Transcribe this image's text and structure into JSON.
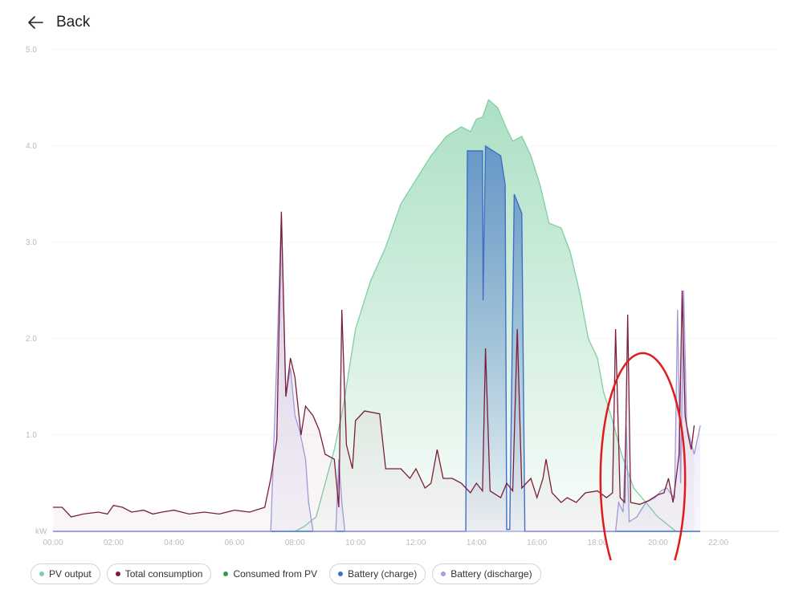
{
  "header": {
    "back_label": "Back",
    "back_icon": "arrow-left-icon"
  },
  "legend": [
    {
      "label": "PV output",
      "color": "#7fd0a7",
      "boxed": true
    },
    {
      "label": "Total consumption",
      "color": "#7b1e3a",
      "boxed": true
    },
    {
      "label": "Consumed from PV",
      "color": "#2e9d4a",
      "boxed": false
    },
    {
      "label": "Battery (charge)",
      "color": "#3f6fc6",
      "boxed": true
    },
    {
      "label": "Battery (discharge)",
      "color": "#a79fe0",
      "boxed": true
    }
  ],
  "chart_data": {
    "type": "area",
    "ylabel": "kW",
    "ylim": [
      0,
      5
    ],
    "yticks": [
      "5.0",
      "4.0",
      "3.0",
      "2.0",
      "1.0"
    ],
    "xticks": [
      "00:00",
      "02:00",
      "04:00",
      "06:00",
      "08:00",
      "10:00",
      "12:00",
      "14:00",
      "16:00",
      "18:00",
      "20:00",
      "22:00"
    ],
    "xlim_hours": [
      0,
      24
    ],
    "grid": true,
    "colors": {
      "pv": "#7fcfa4",
      "consumption": "#7b1e3a",
      "charge": "#3f6fc6",
      "discharge": "#9f98dc",
      "annotation": "#e01b1b"
    },
    "annotation": {
      "shape": "ellipse",
      "center_hour": 19.5,
      "center_kw": 0.55,
      "hour_radius": 1.4,
      "kw_radius": 1.3
    },
    "series": [
      {
        "name": "PV output",
        "points": [
          [
            8.0,
            0
          ],
          [
            8.3,
            0.05
          ],
          [
            8.7,
            0.15
          ],
          [
            9.0,
            0.5
          ],
          [
            9.3,
            0.85
          ],
          [
            9.6,
            1.3
          ],
          [
            10.0,
            2.1
          ],
          [
            10.5,
            2.6
          ],
          [
            11.0,
            2.95
          ],
          [
            11.5,
            3.4
          ],
          [
            12.0,
            3.65
          ],
          [
            12.5,
            3.9
          ],
          [
            13.0,
            4.1
          ],
          [
            13.5,
            4.2
          ],
          [
            13.8,
            4.15
          ],
          [
            14.0,
            4.28
          ],
          [
            14.2,
            4.3
          ],
          [
            14.4,
            4.48
          ],
          [
            14.7,
            4.4
          ],
          [
            15.0,
            4.18
          ],
          [
            15.2,
            4.05
          ],
          [
            15.5,
            4.1
          ],
          [
            15.8,
            3.9
          ],
          [
            16.1,
            3.6
          ],
          [
            16.4,
            3.2
          ],
          [
            16.8,
            3.15
          ],
          [
            17.1,
            2.9
          ],
          [
            17.4,
            2.5
          ],
          [
            17.7,
            2.0
          ],
          [
            18.0,
            1.8
          ],
          [
            18.2,
            1.45
          ],
          [
            18.5,
            1.15
          ],
          [
            18.8,
            0.8
          ],
          [
            19.2,
            0.45
          ],
          [
            19.6,
            0.3
          ],
          [
            20.0,
            0.15
          ],
          [
            20.4,
            0.05
          ],
          [
            20.6,
            0
          ]
        ]
      },
      {
        "name": "Total consumption",
        "points": [
          [
            0.0,
            0.25
          ],
          [
            0.3,
            0.25
          ],
          [
            0.6,
            0.15
          ],
          [
            1.0,
            0.18
          ],
          [
            1.5,
            0.2
          ],
          [
            1.8,
            0.18
          ],
          [
            2.0,
            0.27
          ],
          [
            2.3,
            0.25
          ],
          [
            2.6,
            0.2
          ],
          [
            3.0,
            0.22
          ],
          [
            3.3,
            0.18
          ],
          [
            3.6,
            0.2
          ],
          [
            4.0,
            0.22
          ],
          [
            4.5,
            0.18
          ],
          [
            5.0,
            0.2
          ],
          [
            5.5,
            0.18
          ],
          [
            6.0,
            0.22
          ],
          [
            6.5,
            0.2
          ],
          [
            7.0,
            0.25
          ],
          [
            7.2,
            0.55
          ],
          [
            7.4,
            0.95
          ],
          [
            7.55,
            3.32
          ],
          [
            7.7,
            1.4
          ],
          [
            7.85,
            1.8
          ],
          [
            8.0,
            1.6
          ],
          [
            8.2,
            1.0
          ],
          [
            8.35,
            1.3
          ],
          [
            8.6,
            1.2
          ],
          [
            8.8,
            1.05
          ],
          [
            9.0,
            0.8
          ],
          [
            9.3,
            0.75
          ],
          [
            9.45,
            0.25
          ],
          [
            9.55,
            2.3
          ],
          [
            9.7,
            0.9
          ],
          [
            9.9,
            0.65
          ],
          [
            10.0,
            1.15
          ],
          [
            10.3,
            1.25
          ],
          [
            10.8,
            1.22
          ],
          [
            11.0,
            0.65
          ],
          [
            11.5,
            0.65
          ],
          [
            11.8,
            0.55
          ],
          [
            12.0,
            0.65
          ],
          [
            12.3,
            0.45
          ],
          [
            12.5,
            0.5
          ],
          [
            12.7,
            0.85
          ],
          [
            12.9,
            0.55
          ],
          [
            13.2,
            0.55
          ],
          [
            13.5,
            0.5
          ],
          [
            13.8,
            0.4
          ],
          [
            14.0,
            0.5
          ],
          [
            14.2,
            0.42
          ],
          [
            14.3,
            1.9
          ],
          [
            14.45,
            0.42
          ],
          [
            14.8,
            0.35
          ],
          [
            15.0,
            0.5
          ],
          [
            15.2,
            0.42
          ],
          [
            15.35,
            2.1
          ],
          [
            15.5,
            0.45
          ],
          [
            15.8,
            0.55
          ],
          [
            16.0,
            0.35
          ],
          [
            16.2,
            0.55
          ],
          [
            16.3,
            0.75
          ],
          [
            16.5,
            0.4
          ],
          [
            16.8,
            0.3
          ],
          [
            17.0,
            0.35
          ],
          [
            17.3,
            0.3
          ],
          [
            17.6,
            0.4
          ],
          [
            18.0,
            0.42
          ],
          [
            18.3,
            0.35
          ],
          [
            18.5,
            0.4
          ],
          [
            18.6,
            2.1
          ],
          [
            18.75,
            0.35
          ],
          [
            18.9,
            0.3
          ],
          [
            19.0,
            2.25
          ],
          [
            19.1,
            0.3
          ],
          [
            19.4,
            0.28
          ],
          [
            19.7,
            0.32
          ],
          [
            20.0,
            0.38
          ],
          [
            20.2,
            0.4
          ],
          [
            20.35,
            0.55
          ],
          [
            20.5,
            0.3
          ],
          [
            20.7,
            0.8
          ],
          [
            20.8,
            2.5
          ],
          [
            20.9,
            1.2
          ],
          [
            21.0,
            1.0
          ],
          [
            21.1,
            0.85
          ],
          [
            21.2,
            1.1
          ]
        ]
      },
      {
        "name": "Battery (charge)",
        "points": [
          [
            0.0,
            0
          ],
          [
            13.65,
            0
          ],
          [
            13.7,
            3.95
          ],
          [
            14.2,
            3.95
          ],
          [
            14.22,
            2.4
          ],
          [
            14.3,
            4.0
          ],
          [
            14.8,
            3.9
          ],
          [
            14.95,
            3.6
          ],
          [
            15.0,
            0.02
          ],
          [
            15.1,
            0.02
          ],
          [
            15.25,
            3.5
          ],
          [
            15.5,
            3.3
          ],
          [
            15.6,
            0
          ],
          [
            21.4,
            0
          ]
        ]
      },
      {
        "name": "Battery (discharge)",
        "points": [
          [
            0.0,
            0
          ],
          [
            7.2,
            0
          ],
          [
            7.4,
            1.8
          ],
          [
            7.55,
            3.3
          ],
          [
            7.7,
            1.4
          ],
          [
            7.85,
            1.7
          ],
          [
            8.0,
            1.2
          ],
          [
            8.15,
            1.05
          ],
          [
            8.35,
            0.75
          ],
          [
            8.45,
            0.3
          ],
          [
            8.6,
            0
          ],
          [
            9.35,
            0
          ],
          [
            9.45,
            0.75
          ],
          [
            9.55,
            0.3
          ],
          [
            9.65,
            0
          ],
          [
            18.6,
            0
          ],
          [
            18.7,
            0.3
          ],
          [
            18.85,
            0.2
          ],
          [
            18.95,
            1.1
          ],
          [
            19.05,
            0.1
          ],
          [
            19.3,
            0.15
          ],
          [
            19.6,
            0.3
          ],
          [
            19.9,
            0.35
          ],
          [
            20.1,
            0.42
          ],
          [
            20.3,
            0.45
          ],
          [
            20.45,
            0.38
          ],
          [
            20.55,
            0.35
          ],
          [
            20.65,
            2.3
          ],
          [
            20.75,
            0.5
          ],
          [
            20.85,
            2.5
          ],
          [
            20.95,
            1.1
          ],
          [
            21.2,
            0.8
          ],
          [
            21.4,
            1.1
          ]
        ]
      }
    ]
  }
}
